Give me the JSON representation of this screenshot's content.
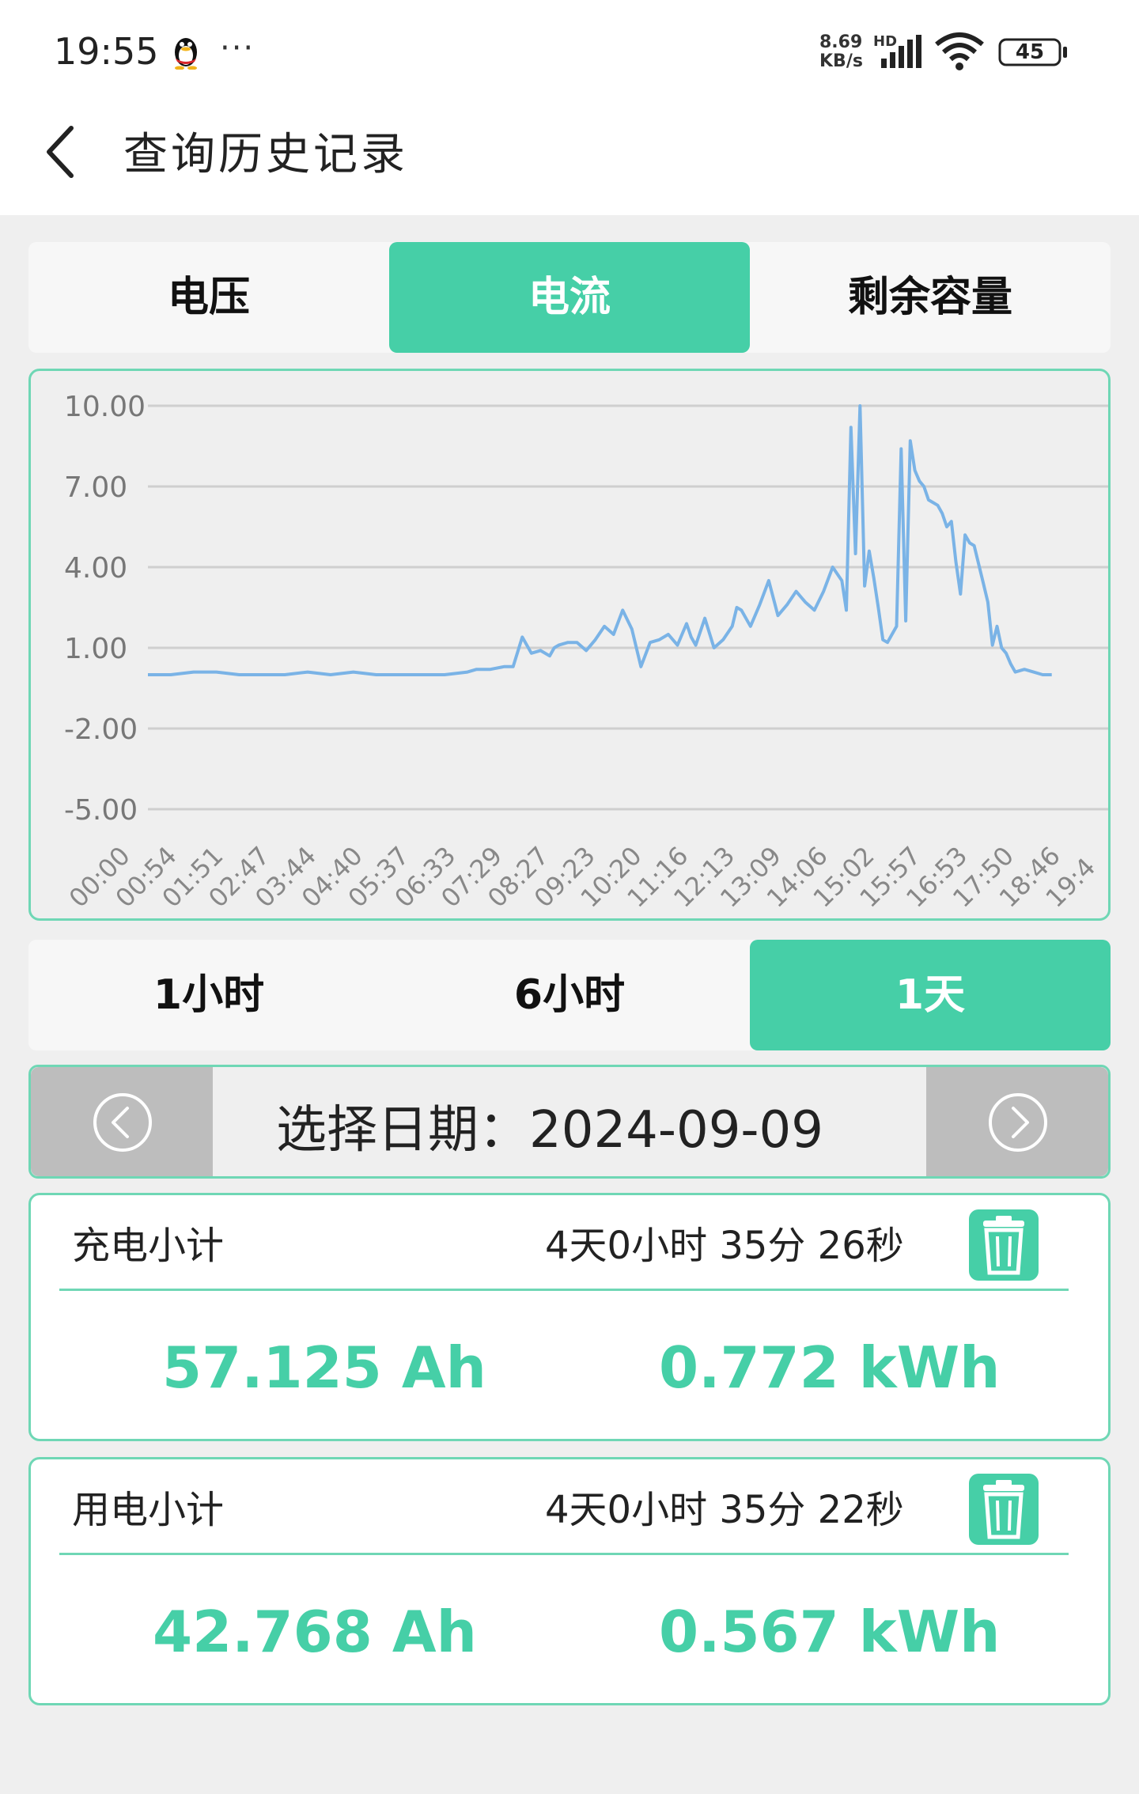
{
  "status": {
    "time": "19:55",
    "more": "···",
    "net_speed_value": "8.69",
    "net_speed_unit": "KB/s",
    "hd_label": "HD",
    "battery": "45"
  },
  "header": {
    "title": "查询历史记录"
  },
  "metric_tabs": [
    {
      "label": "电压",
      "active": false
    },
    {
      "label": "电流",
      "active": true
    },
    {
      "label": "剩余容量",
      "active": false
    }
  ],
  "chart_data": {
    "type": "line",
    "y_ticks": [
      "10.00",
      "7.00",
      "4.00",
      "1.00",
      "-2.00",
      "-5.00"
    ],
    "ylim": [
      -5,
      10
    ],
    "x_ticks": [
      "00:00",
      "00:54",
      "01:51",
      "02:47",
      "03:44",
      "04:40",
      "05:37",
      "06:33",
      "07:29",
      "08:27",
      "09:23",
      "10:20",
      "11:16",
      "12:13",
      "13:09",
      "14:06",
      "15:02",
      "15:57",
      "16:53",
      "17:50",
      "18:46",
      "19:4"
    ],
    "grid": true,
    "line_color": "#7ab3e6",
    "series": [
      {
        "x": [
          0.0,
          0.5,
          1.0,
          1.5,
          2.0,
          2.5,
          3.0,
          3.5,
          4.0,
          4.5,
          5.0,
          5.5,
          6.0,
          6.5,
          7.0,
          7.2,
          7.5,
          7.8,
          8.0,
          8.2,
          8.4,
          8.6,
          8.8,
          8.9,
          9.0,
          9.2,
          9.4,
          9.6,
          9.8,
          10.0,
          10.2,
          10.4,
          10.6,
          10.8,
          11.0,
          11.2,
          11.4,
          11.6,
          11.8,
          11.9,
          12.0,
          12.2,
          12.4,
          12.6,
          12.8,
          12.9,
          13.0,
          13.2,
          13.4,
          13.6,
          13.8,
          14.0,
          14.2,
          14.4,
          14.6,
          14.8,
          15.0,
          15.2,
          15.3,
          15.4,
          15.5,
          15.6,
          15.7,
          15.8,
          15.9,
          16.0,
          16.1,
          16.2,
          16.3,
          16.4,
          16.5,
          16.6,
          16.7,
          16.8,
          16.9,
          17.0,
          17.1,
          17.2,
          17.3,
          17.4,
          17.5,
          17.6,
          17.7,
          17.8,
          17.9,
          18.0,
          18.1,
          18.2,
          18.3,
          18.4,
          18.5,
          18.6,
          18.7,
          18.8,
          18.9,
          19.0,
          19.2,
          19.4,
          19.6,
          19.8
        ],
        "y": [
          0.0,
          0.0,
          0.1,
          0.1,
          0.0,
          0.0,
          0.0,
          0.1,
          0.0,
          0.1,
          0.0,
          0.0,
          0.0,
          0.0,
          0.1,
          0.2,
          0.2,
          0.3,
          0.3,
          1.4,
          0.8,
          0.9,
          0.7,
          1.0,
          1.1,
          1.2,
          1.2,
          0.9,
          1.3,
          1.8,
          1.5,
          2.4,
          1.7,
          0.3,
          1.2,
          1.3,
          1.5,
          1.1,
          1.9,
          1.4,
          1.1,
          2.1,
          1.0,
          1.3,
          1.8,
          2.5,
          2.4,
          1.8,
          2.6,
          3.5,
          2.2,
          2.6,
          3.1,
          2.7,
          2.4,
          3.1,
          4.0,
          3.5,
          2.4,
          9.2,
          4.5,
          10.0,
          3.3,
          4.6,
          3.6,
          2.5,
          1.3,
          1.2,
          1.5,
          1.8,
          8.4,
          2.0,
          8.7,
          7.6,
          7.2,
          7.0,
          6.5,
          6.4,
          6.3,
          6.0,
          5.5,
          5.7,
          4.2,
          3.0,
          5.2,
          4.9,
          4.8,
          4.1,
          3.4,
          2.7,
          1.1,
          1.8,
          1.0,
          0.8,
          0.4,
          0.1,
          0.2,
          0.1,
          0.0,
          0.0
        ]
      }
    ]
  },
  "range_tabs": [
    {
      "label": "1小时",
      "active": false
    },
    {
      "label": "6小时",
      "active": false
    },
    {
      "label": "1天",
      "active": true
    }
  ],
  "date_picker": {
    "label": "选择日期：",
    "date": "2024-09-09"
  },
  "charge_summary": {
    "title": "充电小计",
    "duration": "4天0小时 35分 26秒",
    "ah": "57.125 Ah",
    "kwh": "0.772 kWh"
  },
  "use_summary": {
    "title": "用电小计",
    "duration": "4天0小时 35分 22秒",
    "ah": "42.768 Ah",
    "kwh": "0.567 kWh"
  }
}
